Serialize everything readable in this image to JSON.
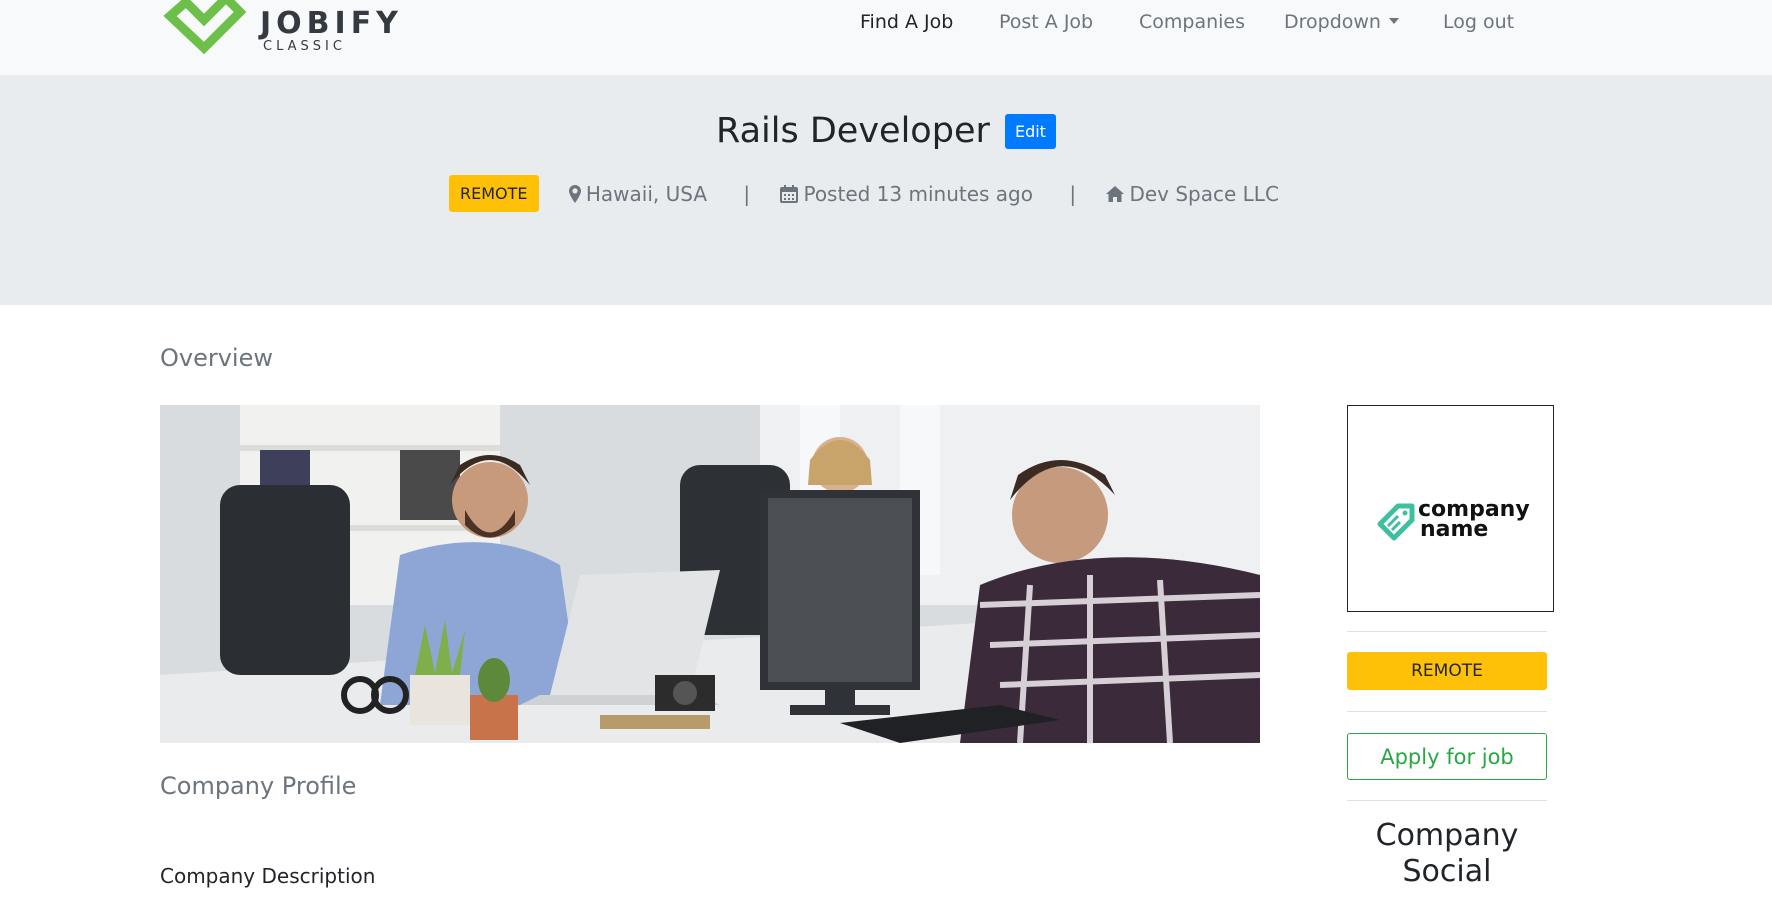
{
  "brand": {
    "name": "JOBIFY",
    "sub": "CLASSIC",
    "color": "#6cc04a"
  },
  "nav": {
    "items": [
      {
        "label": "Find A Job"
      },
      {
        "label": "Post A Job"
      },
      {
        "label": "Companies"
      },
      {
        "label": "Dropdown"
      },
      {
        "label": "Log out"
      }
    ]
  },
  "job": {
    "title": "Rails Developer",
    "edit_label": "Edit",
    "badge": "REMOTE",
    "location": "Hawaii, USA",
    "posted": "Posted 13 minutes ago",
    "company": "Dev Space LLC",
    "separator": "|"
  },
  "main": {
    "overview_heading": "Overview",
    "profile_heading": "Company Profile",
    "description_label": "Company Description"
  },
  "sidebar": {
    "logo_text_line1": "company",
    "logo_text_line2": "name",
    "remote_label": "REMOTE",
    "apply_label": "Apply for job",
    "social_heading": "Company Social"
  },
  "colors": {
    "primary": "#007bff",
    "warning": "#ffc107",
    "success": "#28a745",
    "hero_bg": "#e9ecef",
    "nav_bg": "#f8f9fa",
    "logo_teal": "#3dbfa0"
  },
  "icons": {
    "location": "map-marker-icon",
    "posted": "calendar-icon",
    "company": "home-icon"
  }
}
